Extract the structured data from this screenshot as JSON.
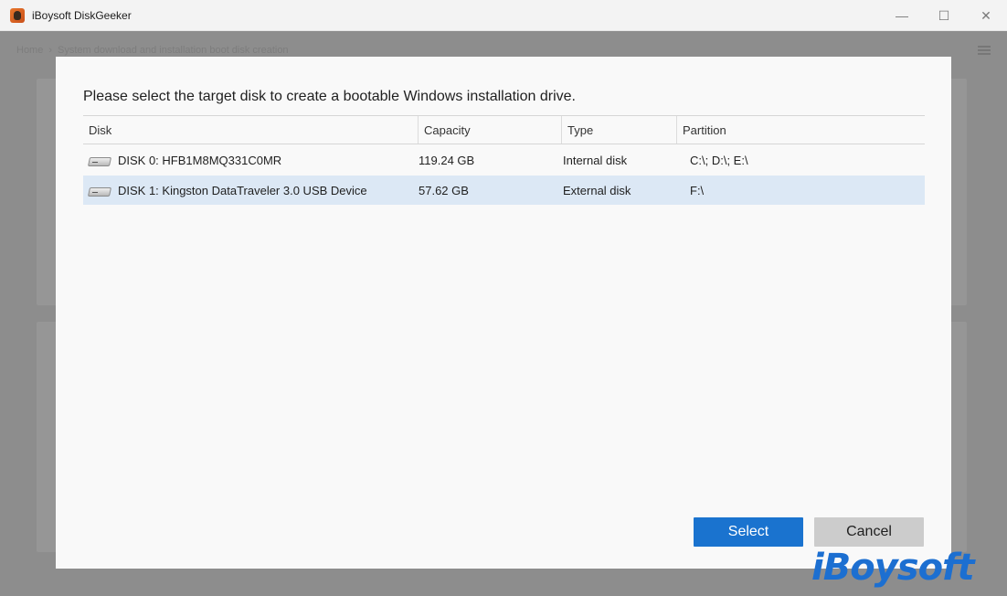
{
  "window": {
    "title": "iBoysoft DiskGeeker",
    "controls": {
      "minimize": "—",
      "maximize": "☐",
      "close": "✕"
    }
  },
  "background": {
    "breadcrumb": [
      "Home",
      "›",
      "System download and installation boot disk creation"
    ]
  },
  "dialog": {
    "heading": "Please select the target disk to create a bootable Windows installation drive.",
    "columns": [
      "Disk",
      "Capacity",
      "Type",
      "Partition"
    ],
    "rows": [
      {
        "disk": "DISK 0: HFB1M8MQ331C0MR",
        "capacity": "119.24 GB",
        "type": "Internal disk",
        "partition": "C:\\; D:\\; E:\\",
        "selected": false
      },
      {
        "disk": "DISK 1: Kingston DataTraveler 3.0 USB Device",
        "capacity": "57.62 GB",
        "type": "External disk",
        "partition": "F:\\",
        "selected": true
      }
    ],
    "buttons": {
      "select": "Select",
      "cancel": "Cancel"
    }
  },
  "watermark": "iBoysoft",
  "colors": {
    "accent": "#1a73cf",
    "selected_row": "#dce8f5",
    "watermark": "#1c6fd1"
  }
}
